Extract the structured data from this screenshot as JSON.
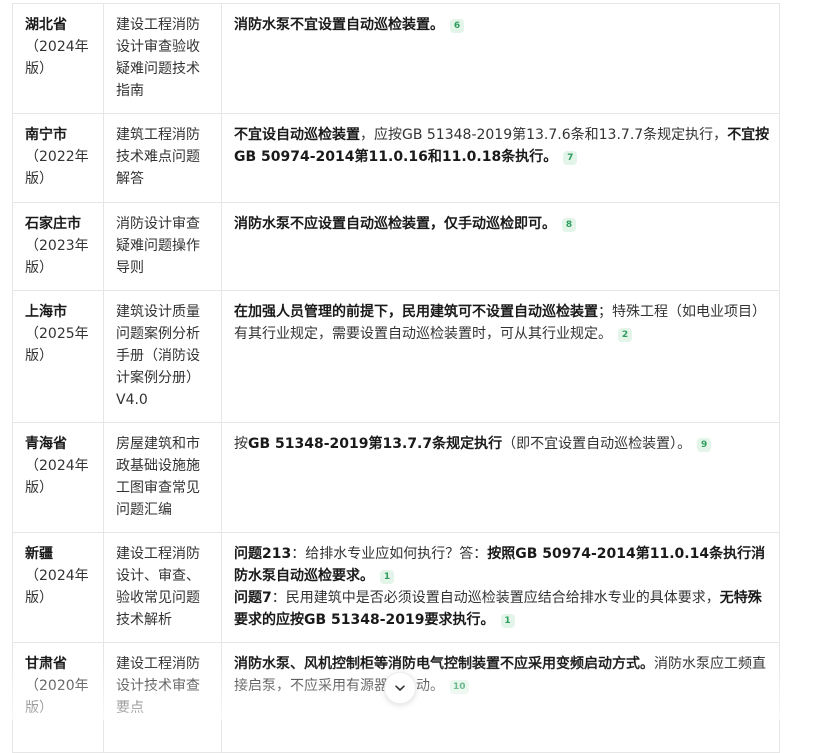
{
  "table": {
    "rows": [
      {
        "region": "湖北省",
        "edition": "（2024年版）",
        "document": "建设工程消防设计审查验收疑难问题技术指南",
        "content": [
          {
            "segments": [
              "消防水泵不宜设置自动巡检装置。"
            ],
            "citation": "6"
          }
        ]
      },
      {
        "region": "南宁市",
        "edition": "（2022年版）",
        "document": "建筑工程消防技术难点问题解答",
        "content": [
          {
            "segments": [
              "不宜设自动巡检装置",
              "，应按GB 51348-2019第13.7.6条和13.7.7条规定执行，",
              "不宜按GB 50974-2014第11.0.16和11.0.18条执行。"
            ],
            "citation": "7"
          }
        ]
      },
      {
        "region": "石家庄市",
        "edition": "（2023年版）",
        "document": "消防设计审查疑难问题操作导则",
        "content": [
          {
            "segments": [
              "消防水泵不应设置自动巡检装置，仅手动巡检即可。"
            ],
            "citation": "8"
          }
        ]
      },
      {
        "region": "上海市",
        "edition": "（2025年版）",
        "document": "建筑设计质量问题案例分析手册（消防设计案例分册）V4.0",
        "content": [
          {
            "segments": [
              "在加强人员管理的前提下，民用建筑可不设置自动巡检装置",
              "；特殊工程（如电业项目）有其行业规定，需要设置自动巡检装置时，可从其行业规定。"
            ],
            "citation": "2"
          }
        ]
      },
      {
        "region": "青海省",
        "edition": "（2024年版）",
        "document": "房屋建筑和市政基础设施施工图审查常见问题汇编",
        "content": [
          {
            "segments": [
              "按",
              "GB 51348-2019第13.7.7条规定执行",
              "（即不宜设置自动巡检装置）。"
            ],
            "citation": "9"
          }
        ]
      },
      {
        "region": "新疆",
        "edition": "（2024年版）",
        "document": "建设工程消防设计、审查、验收常见问题技术解析",
        "content": [
          {
            "segments": [
              "问题213",
              "：给排水专业应如何执行？答：",
              "按照GB 50974-2014第11.0.14条执行消防水泵自动巡检要求。"
            ],
            "citation": "1"
          },
          {
            "segments": [
              "问题7",
              "：民用建筑中是否必须设置自动巡检装置应结合给排水专业的具体要求，",
              "无特殊要求的应按GB 51348-2019要求执行。"
            ],
            "citation": "1"
          }
        ]
      },
      {
        "region": "甘肃省",
        "edition": "（2020年版）",
        "document": "建设工程消防设计技术审查要点",
        "content": [
          {
            "segments": [
              "消防水泵、风机控制柜等消防电气控制装置不应采用变频启动方式。",
              "消防水泵应工频直接启泵，不应采用有源器",
              "动。"
            ],
            "citation": "10"
          }
        ]
      }
    ]
  },
  "scroll_button": {
    "icon": "chevron-down-icon"
  },
  "colors": {
    "citation_text": "#2f9d5d",
    "citation_background": "#e3f4e9",
    "border": "#e6e6e6",
    "strong_text": "#1a1a1a",
    "body_text": "#333333",
    "page_background": "#ffffff"
  }
}
